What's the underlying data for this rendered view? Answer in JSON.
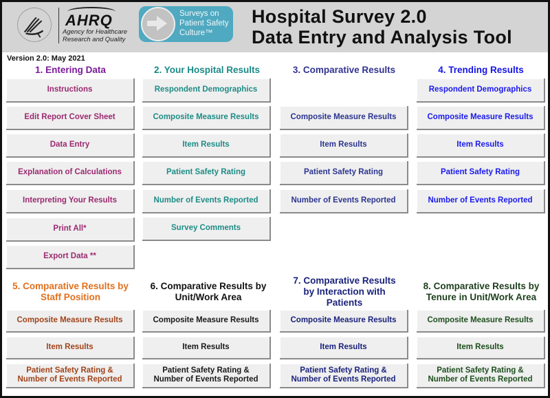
{
  "header": {
    "agency_name": "AHRQ",
    "agency_subtitle_line1": "Agency for Healthcare",
    "agency_subtitle_line2": "Research and Quality",
    "program_logo_line1": "Surveys on",
    "program_logo_line2": "Patient Safety",
    "program_logo_line3": "Culture™",
    "title_line1": "Hospital Survey 2.0",
    "title_line2": "Data Entry and Analysis Tool",
    "hhs_seal_icon": "hhs-eagle-seal-icon",
    "program_arrow_icon": "arrow-right-icon"
  },
  "version": "Version 2.0: May 2021",
  "sections": {
    "s1": {
      "heading": "1. Entering Data",
      "color": "#7a1a9a",
      "buttons": [
        "Instructions",
        "Edit Report Cover Sheet",
        "Data Entry",
        "Explanation of Calculations",
        "Interpreting Your Results",
        "Print All*",
        "Export Data **"
      ]
    },
    "s2": {
      "heading": "2. Your Hospital Results",
      "color": "#198a86",
      "buttons": [
        "Respondent Demographics",
        "Composite Measure Results",
        "Item Results",
        "Patient Safety Rating",
        "Number of Events Reported",
        "Survey Comments"
      ]
    },
    "s3": {
      "heading": "3. Comparative Results",
      "color": "#313391",
      "buttons": [
        "Composite Measure Results",
        "Item Results",
        "Patient Safety Rating",
        "Number of Events Reported"
      ]
    },
    "s4": {
      "heading": "4. Trending Results",
      "color": "#1414e6",
      "buttons": [
        "Respondent Demographics",
        "Composite Measure Results",
        "Item Results",
        "Patient Safety Rating",
        "Number of Events Reported"
      ]
    },
    "s5": {
      "heading_line1": "5. Comparative Results by",
      "heading_line2": "Staff Position",
      "color": "#e2701c",
      "buttons": [
        "Composite Measure Results",
        "Item Results"
      ],
      "last_button_line1": "Patient Safety Rating &",
      "last_button_line2": "Number of Events Reported"
    },
    "s6": {
      "heading_line1": "6. Comparative Results by",
      "heading_line2": "Unit/Work Area",
      "color": "#111111",
      "buttons": [
        "Composite Measure Results",
        "Item Results"
      ],
      "last_button_line1": "Patient Safety Rating &",
      "last_button_line2": "Number of Events Reported"
    },
    "s7": {
      "heading_line1": "7. Comparative Results",
      "heading_line2": "by Interaction with",
      "heading_line3": "Patients",
      "color": "#1b237c",
      "buttons": [
        "Composite Measure Results",
        "Item Results"
      ],
      "last_button_line1": "Patient Safety Rating &",
      "last_button_line2": "Number of Events Reported"
    },
    "s8": {
      "heading_line1": "8. Comparative Results by",
      "heading_line2": "Tenure in Unit/Work Area",
      "color": "#1d3f1d",
      "buttons": [
        "Composite Measure Results",
        "Item Results"
      ],
      "last_button_line1": "Patient Safety Rating &",
      "last_button_line2": "Number of Events Reported"
    }
  }
}
